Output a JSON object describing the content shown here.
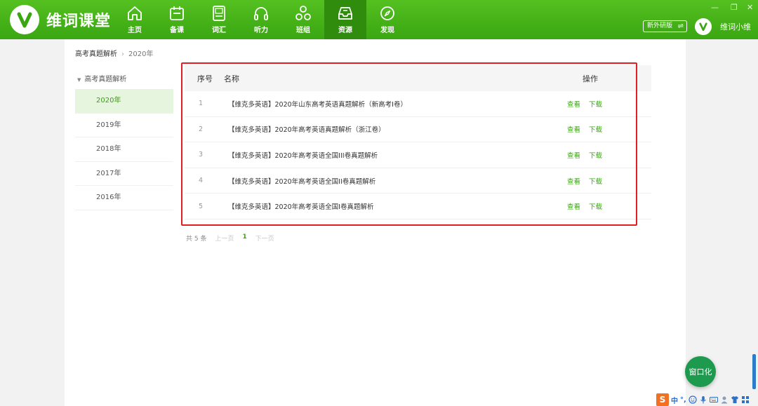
{
  "app": {
    "name": "维词课堂"
  },
  "nav": [
    {
      "label": "主页",
      "icon": "home-icon"
    },
    {
      "label": "备课",
      "icon": "calendar-icon"
    },
    {
      "label": "词汇",
      "icon": "vocab-card-icon"
    },
    {
      "label": "听力",
      "icon": "headphones-icon"
    },
    {
      "label": "班组",
      "icon": "group-icon"
    },
    {
      "label": "资源",
      "icon": "resource-inbox-icon",
      "active": true
    },
    {
      "label": "发现",
      "icon": "compass-icon"
    }
  ],
  "header": {
    "edition_label": "新外研版",
    "swap_icon": "swap-arrows-icon",
    "username": "维词小维",
    "window_controls": {
      "minimize": "—",
      "restore": "❐",
      "close": "✕"
    }
  },
  "breadcrumb": {
    "root": "高考真题解析",
    "current": "2020年"
  },
  "sidebar": {
    "group_label": "高考真题解析",
    "items": [
      "2020年",
      "2019年",
      "2018年",
      "2017年",
      "2016年"
    ],
    "active_index": 0
  },
  "table": {
    "headers": {
      "index": "序号",
      "name": "名称",
      "ops": "操作"
    },
    "rows": [
      {
        "index": "1",
        "name": "【维克多英语】2020年山东高考英语真题解析（新高考Ⅰ卷）"
      },
      {
        "index": "2",
        "name": "【维克多英语】2020年高考英语真题解析（浙江卷）"
      },
      {
        "index": "3",
        "name": "【维克多英语】2020年高考英语全国III卷真题解析"
      },
      {
        "index": "4",
        "name": "【维克多英语】2020年高考英语全国II卷真题解析"
      },
      {
        "index": "5",
        "name": "【维克多英语】2020年高考英语全国I卷真题解析"
      }
    ],
    "view_label": "查看",
    "download_label": "下载"
  },
  "pagination": {
    "total": "共 5 条",
    "prev": "上一页",
    "page": "1",
    "next": "下一页"
  },
  "float_button": {
    "label": "窗口化"
  },
  "ime": {
    "logo": "S",
    "mode": "中",
    "punct": "°,"
  },
  "colors": {
    "brand_green": "#3aa612",
    "highlight_red": "#e02020",
    "float_button": "#1e9a4e"
  }
}
